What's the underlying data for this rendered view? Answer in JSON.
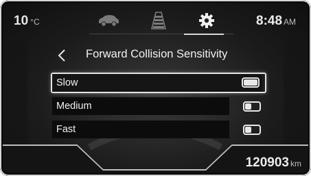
{
  "status_bar": {
    "temperature": "10",
    "temperature_unit": "°C",
    "time": "8:48",
    "time_suffix": "AM"
  },
  "tabs": [
    {
      "icon": "car-icon",
      "selected": false
    },
    {
      "icon": "lane-icon",
      "selected": false
    },
    {
      "icon": "gear-icon",
      "selected": true
    }
  ],
  "header": {
    "back_icon": "chevron-left-icon",
    "title": "Forward Collision Sensitivity"
  },
  "options": [
    {
      "label": "Slow",
      "on": true,
      "selected": true
    },
    {
      "label": "Medium",
      "on": false,
      "selected": false
    },
    {
      "label": "Fast",
      "on": false,
      "selected": false
    }
  ],
  "odometer": {
    "value": "120903",
    "unit": "km"
  },
  "colors": {
    "background": "#1c1c1c",
    "text": "#f2f2f2",
    "highlight_border": "#e4e4e4"
  }
}
